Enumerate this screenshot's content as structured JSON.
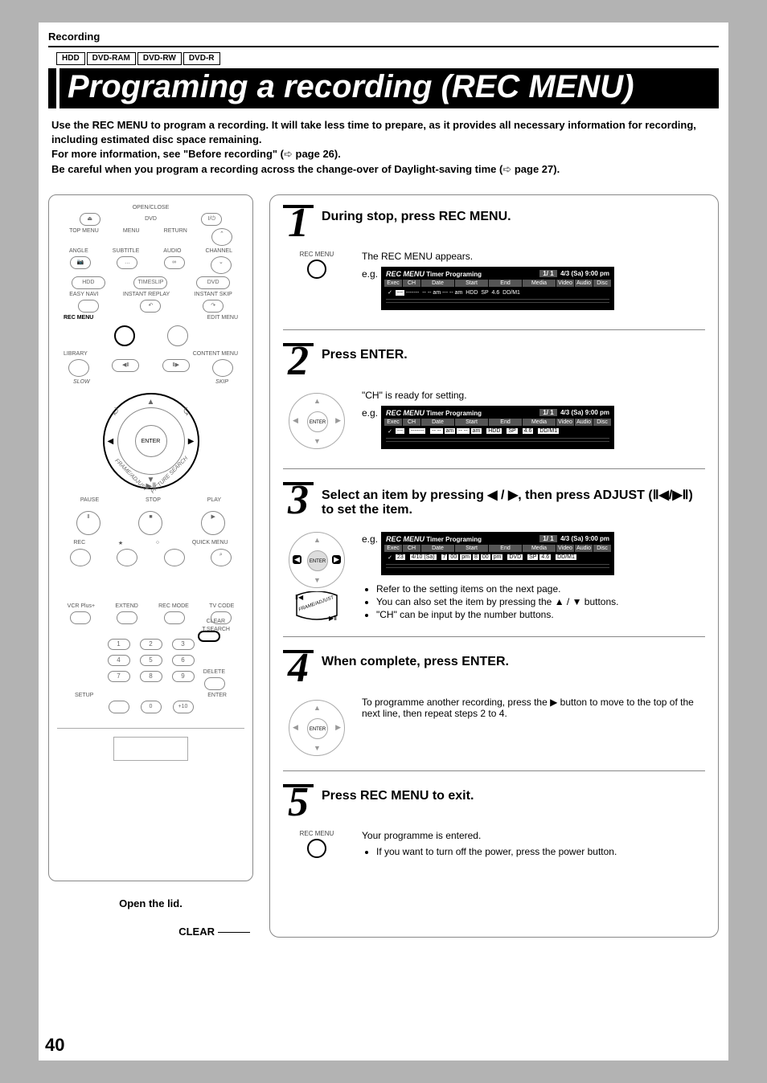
{
  "breadcrumb": "Recording",
  "badges": [
    "HDD",
    "DVD-RAM",
    "DVD-RW",
    "DVD-R"
  ],
  "title": "Programing a recording (REC MENU)",
  "intro": {
    "p1": "Use the REC MENU to program a recording. It will take less time to prepare, as it provides all necessary information for recording, including estimated disc space remaining.",
    "p2a": "For more information, see \"Before recording\" (",
    "p2b": " page 26).",
    "p3a": "Be careful when you program a recording across the change-over of Daylight-saving time (",
    "p3b": " page 27)."
  },
  "remote": {
    "open_lid": "Open the lid.",
    "clear": "CLEAR",
    "rec_menu": "REC MENU",
    "edit_menu": "EDIT MENU",
    "library": "LIBRARY",
    "content_menu": "CONTENT MENU",
    "enter": "ENTER",
    "pause": "PAUSE",
    "stop": "STOP",
    "play": "PLAY",
    "rec": "REC",
    "quick_menu": "QUICK MENU",
    "frame_adjust": "FRAME/ADJUST",
    "picture_search": "PICTURE SEARCH",
    "slow": "SLOW",
    "skip": "SKIP",
    "hdd": "HDD",
    "timeslip": "TIMESLIP",
    "dvd": "DVD",
    "easy_navi": "EASY NAVI",
    "instant_replay": "INSTANT REPLAY",
    "instant_skip": "INSTANT SKIP",
    "open_close": "OPEN/CLOSE",
    "top_menu": "TOP MENU",
    "menu": "MENU",
    "return": "RETURN",
    "angle": "ANGLE",
    "subtitle": "SUBTITLE",
    "audio": "AUDIO",
    "channel": "CHANNEL",
    "vcr_plus": "VCR Plus+",
    "extend": "EXTEND",
    "rec_mode": "REC MODE",
    "tv_code": "TV CODE",
    "t_search": "T.SEARCH",
    "clear_btn": "CLEAR",
    "delete": "DELETE",
    "setup": "SETUP",
    "enter_btn": "ENTER"
  },
  "steps": [
    {
      "num": "1",
      "title": "During stop, press REC MENU.",
      "icon_label": "REC MENU",
      "body_text": "The REC MENU appears.",
      "eg": "e.g.",
      "screen": {
        "rec": "REC MENU",
        "title": "Timer Programing",
        "page": "1/ 1",
        "datetime": "4/3 (Sa)  9:00  pm",
        "cols": [
          "Exec",
          "CH",
          "Date",
          "Start",
          "End",
          "Media",
          "Video",
          "Audio",
          "Disc"
        ],
        "row": "✓  ---  -------  -- -- am --- -- am  HDD  SP  4.6  DD/M1"
      }
    },
    {
      "num": "2",
      "title": "Press ENTER.",
      "body_text": "\"CH\" is ready for setting.",
      "eg": "e.g.",
      "screen": {
        "rec": "REC MENU",
        "title": "Timer Programing",
        "page": "1/ 1",
        "datetime": "4/3 (Sa)  9:00  pm",
        "cols": [
          "Exec",
          "CH",
          "Date",
          "Start",
          "End",
          "Media",
          "Video",
          "Audio",
          "Disc"
        ],
        "row": "✓  ---  -------  -- -- am  -- -- am  HDD  SP  4.6  DD/M1"
      }
    },
    {
      "num": "3",
      "title_a": "Select an item by pressing ",
      "title_b": " / ",
      "title_c": ", then press ADJUST (",
      "title_d": ") to set the item.",
      "eg": "e.g.",
      "screen": {
        "rec": "REC MENU",
        "title": "Timer Programing",
        "page": "1/ 1",
        "datetime": "4/3 (Sa)  9:00  pm",
        "cols": [
          "Exec",
          "CH",
          "Date",
          "Start",
          "End",
          "Media",
          "Video",
          "Audio",
          "Disc"
        ],
        "row": "✓  23  4/10 (Sa)  7 00 pm  8 00 pm  DVD  SP  4.6  DD/M1"
      },
      "bullets": [
        "Refer to the setting items on the next page.",
        "You can also set the item by pressing the ▲ / ▼ buttons.",
        "\"CH\" can be input by the number buttons."
      ]
    },
    {
      "num": "4",
      "title": "When complete, press ENTER.",
      "body_text": "To programme another recording, press the ▶ button to move to the top of the next line, then repeat steps 2 to 4."
    },
    {
      "num": "5",
      "title": "Press REC MENU to exit.",
      "icon_label": "REC MENU",
      "body_text": "Your programme is entered.",
      "bullets": [
        "If you want to turn off the power, press the power button."
      ]
    }
  ],
  "page_number": "40"
}
